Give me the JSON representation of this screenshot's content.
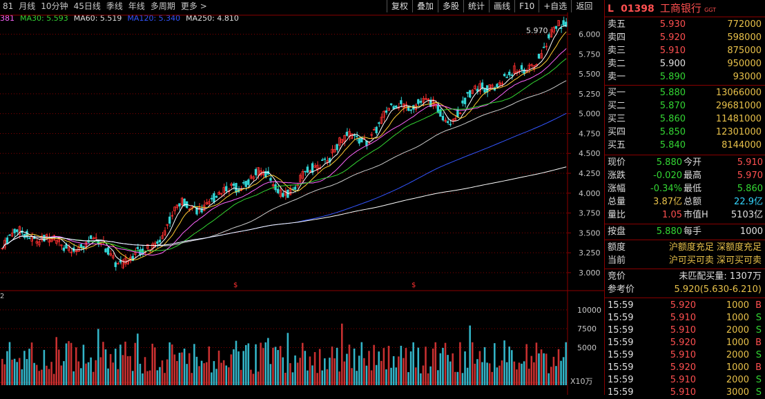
{
  "toolbar_left": [
    "81",
    "月线",
    "10分钟",
    "45日线",
    "季线",
    "年线",
    "多周期",
    "更多 >"
  ],
  "toolbar_right": [
    "复权",
    "叠加",
    "多股",
    "统计",
    "画线",
    "F10",
    "+自选",
    "返回"
  ],
  "ma": [
    {
      "label": "MA30: 5.593",
      "color": "#33d633"
    },
    {
      "label": "MA60: 5.519",
      "color": "#e0e0e0"
    },
    {
      "label": "MA120: 5.340",
      "color": "#3355ff"
    },
    {
      "label": "MA250: 4.810",
      "color": "#e0e0e0"
    }
  ],
  "ma_prefix": "381",
  "chart_data": {
    "type": "candlestick",
    "price_ticks": [
      "6.000",
      "5.750",
      "5.500",
      "5.250",
      "5.000",
      "4.750",
      "4.500",
      "4.250",
      "4.000",
      "3.750",
      "3.500",
      "3.250",
      "3.000"
    ],
    "volume_ticks": [
      "10000",
      "7500",
      "5000"
    ],
    "volume_unit": "X10万",
    "high_marker": "5.970",
    "marker_symbol": "$",
    "volume_panel_label": "2"
  },
  "stock": {
    "market": "L",
    "code": "01398",
    "name": "工商银行",
    "tag": "GGT"
  },
  "asks": [
    {
      "label": "卖五",
      "price": "5.930",
      "vol": "772000",
      "pc": "red"
    },
    {
      "label": "卖四",
      "price": "5.920",
      "vol": "598000",
      "pc": "red"
    },
    {
      "label": "卖三",
      "price": "5.910",
      "vol": "875000",
      "pc": "red"
    },
    {
      "label": "卖二",
      "price": "5.900",
      "vol": "950000",
      "pc": "white"
    },
    {
      "label": "卖一",
      "price": "5.890",
      "vol": "93000",
      "pc": "green"
    }
  ],
  "bids": [
    {
      "label": "买一",
      "price": "5.880",
      "vol": "13066000",
      "pc": "green"
    },
    {
      "label": "买二",
      "price": "5.870",
      "vol": "29681000",
      "pc": "green"
    },
    {
      "label": "买三",
      "price": "5.860",
      "vol": "11481000",
      "pc": "green"
    },
    {
      "label": "买四",
      "price": "5.850",
      "vol": "12301000",
      "pc": "green"
    },
    {
      "label": "买五",
      "price": "5.840",
      "vol": "8144000",
      "pc": "green"
    }
  ],
  "quote": [
    {
      "l1": "现价",
      "v1": "5.880",
      "c1": "green",
      "l2": "今开",
      "v2": "5.910",
      "c2": "red"
    },
    {
      "l1": "涨跌",
      "v1": "-0.020",
      "c1": "green",
      "l2": "最高",
      "v2": "5.970",
      "c2": "red"
    },
    {
      "l1": "涨幅",
      "v1": "-0.34%",
      "c1": "green",
      "l2": "最低",
      "v2": "5.860",
      "c2": "green"
    },
    {
      "l1": "总量",
      "v1": "3.87亿",
      "c1": "yellow",
      "l2": "总额",
      "v2": "22.9亿",
      "c2": "cyan"
    },
    {
      "l1": "量比",
      "v1": "1.05",
      "c1": "red",
      "l2": "市值H",
      "v2": "5103亿",
      "c2": "white"
    }
  ],
  "pan": {
    "l1": "按盘",
    "v1": "5.880",
    "l2": "每手",
    "v2": "1000"
  },
  "quota": {
    "l1": "额度",
    "v1": "沪额度充足 深额度充足",
    "l2": "当前",
    "v2": "沪可买可卖 深可买可卖"
  },
  "auction": {
    "l1": "竞价",
    "v1": "未匹配买量: 1307万",
    "l2": "参考价",
    "v2": "5.920(5.630-6.210)"
  },
  "trades": [
    {
      "time": "15:59",
      "price": "5.920",
      "vol": "1000",
      "bs": "B"
    },
    {
      "time": "15:59",
      "price": "5.910",
      "vol": "1000",
      "bs": "S"
    },
    {
      "time": "15:59",
      "price": "5.910",
      "vol": "2000",
      "bs": "S"
    },
    {
      "time": "15:59",
      "price": "5.920",
      "vol": "1000",
      "bs": "B"
    },
    {
      "time": "15:59",
      "price": "5.910",
      "vol": "2000",
      "bs": "S"
    },
    {
      "time": "15:59",
      "price": "5.920",
      "vol": "1000",
      "bs": "B"
    },
    {
      "time": "15:59",
      "price": "5.910",
      "vol": "2000",
      "bs": "S"
    },
    {
      "time": "15:59",
      "price": "5.910",
      "vol": "3000",
      "bs": "S"
    }
  ]
}
